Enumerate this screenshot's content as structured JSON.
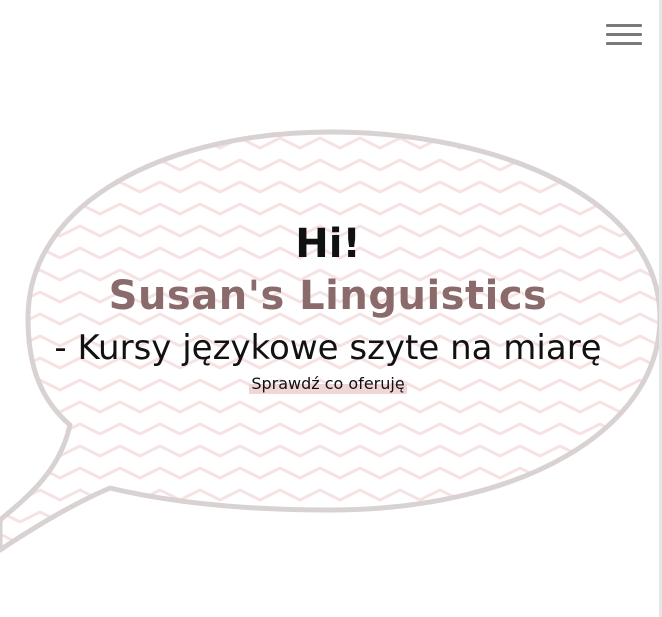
{
  "header": {
    "menu_icon": "hamburger-menu-icon"
  },
  "hero": {
    "greeting": "Hi!",
    "brand_name": "Susan's Linguistics",
    "tagline": "- Kursy językowe szyte na miarę",
    "cta_label": "Sprawdź co oferuję"
  },
  "colors": {
    "brand": "#8a6a6a",
    "bubble_outline": "#d9d2d2",
    "zigzag": "#f6e2e2",
    "highlight": "#f0d6d6",
    "menu_icon": "#7a7a7a"
  }
}
